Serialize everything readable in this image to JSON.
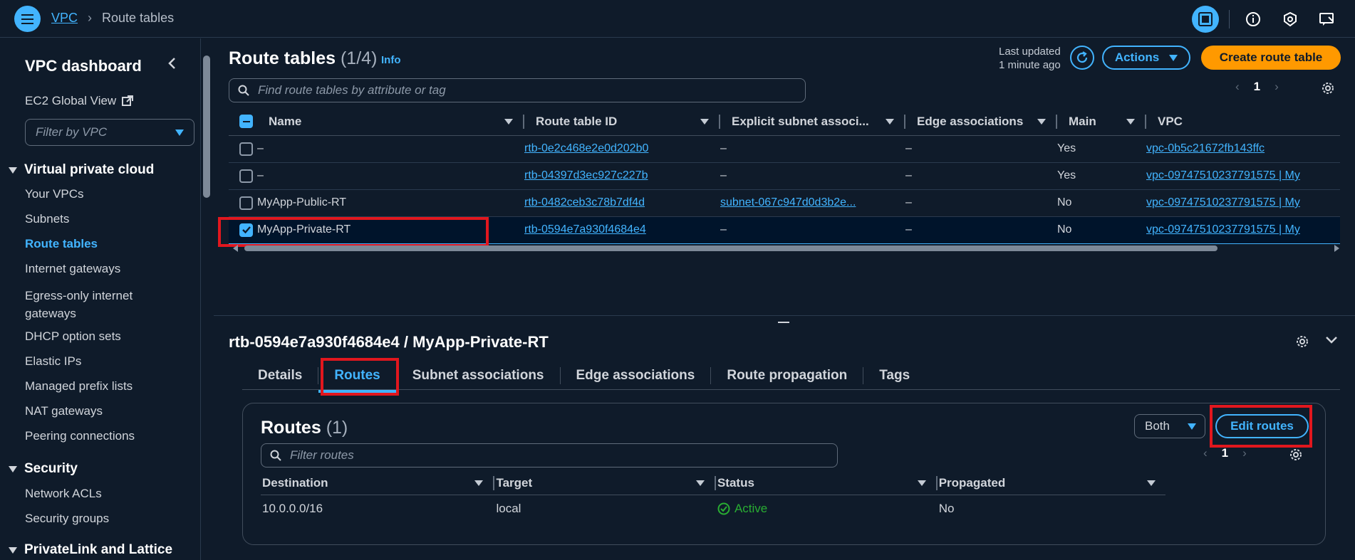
{
  "header": {
    "breadcrumb": [
      "VPC",
      "Route tables"
    ],
    "icons": [
      "panel-icon",
      "info-icon",
      "shield-icon",
      "feedback-icon"
    ]
  },
  "sidebar": {
    "title": "VPC dashboard",
    "ec2_global_view": "EC2 Global View",
    "filter_placeholder": "Filter by VPC",
    "sections": [
      {
        "title": "Virtual private cloud",
        "items": [
          "Your VPCs",
          "Subnets",
          "Route tables",
          "Internet gateways",
          "Egress-only internet gateways",
          "DHCP option sets",
          "Elastic IPs",
          "Managed prefix lists",
          "NAT gateways",
          "Peering connections"
        ]
      },
      {
        "title": "Security",
        "items": [
          "Network ACLs",
          "Security groups"
        ]
      },
      {
        "title": "PrivateLink and Lattice",
        "items": []
      }
    ],
    "active_item": "Route tables"
  },
  "list": {
    "title": "Route tables",
    "count": "(1/4)",
    "info": "Info",
    "last_updated_label": "Last updated",
    "last_updated_value": "1 minute ago",
    "actions_label": "Actions",
    "create_label": "Create route table",
    "search_placeholder": "Find route tables by attribute or tag",
    "page": "1",
    "columns": [
      "Name",
      "Route table ID",
      "Explicit subnet associ...",
      "Edge associations",
      "Main",
      "VPC"
    ],
    "rows": [
      {
        "name": "–",
        "id": "rtb-0e2c468e2e0d202b0",
        "subnet": "–",
        "edge": "–",
        "main": "Yes",
        "vpc": "vpc-0b5c21672fb143ffc",
        "selected": false
      },
      {
        "name": "–",
        "id": "rtb-04397d3ec927c227b",
        "subnet": "–",
        "edge": "–",
        "main": "Yes",
        "vpc": "vpc-09747510237791575 | My",
        "selected": false
      },
      {
        "name": "MyApp-Public-RT",
        "id": "rtb-0482ceb3c78b7df4d",
        "subnet": "subnet-067c947d0d3b2e...",
        "edge": "–",
        "main": "No",
        "vpc": "vpc-09747510237791575 | My",
        "selected": false
      },
      {
        "name": "MyApp-Private-RT",
        "id": "rtb-0594e7a930f4684e4",
        "subnet": "–",
        "edge": "–",
        "main": "No",
        "vpc": "vpc-09747510237791575 | My",
        "selected": true
      }
    ]
  },
  "detail": {
    "title": "rtb-0594e7a930f4684e4 / MyApp-Private-RT",
    "tabs": [
      "Details",
      "Routes",
      "Subnet associations",
      "Edge associations",
      "Route propagation",
      "Tags"
    ],
    "active_tab": "Routes",
    "routes": {
      "title": "Routes",
      "count": "(1)",
      "filter_select": "Both",
      "edit_label": "Edit routes",
      "search_placeholder": "Filter routes",
      "page": "1",
      "columns": [
        "Destination",
        "Target",
        "Status",
        "Propagated"
      ],
      "rows": [
        {
          "destination": "10.0.0.0/16",
          "target": "local",
          "status": "Active",
          "propagated": "No"
        }
      ]
    }
  },
  "colors": {
    "accent": "#42b4ff",
    "primary_button": "#ff9900",
    "highlight": "#e1171e",
    "success": "#29ad32"
  }
}
